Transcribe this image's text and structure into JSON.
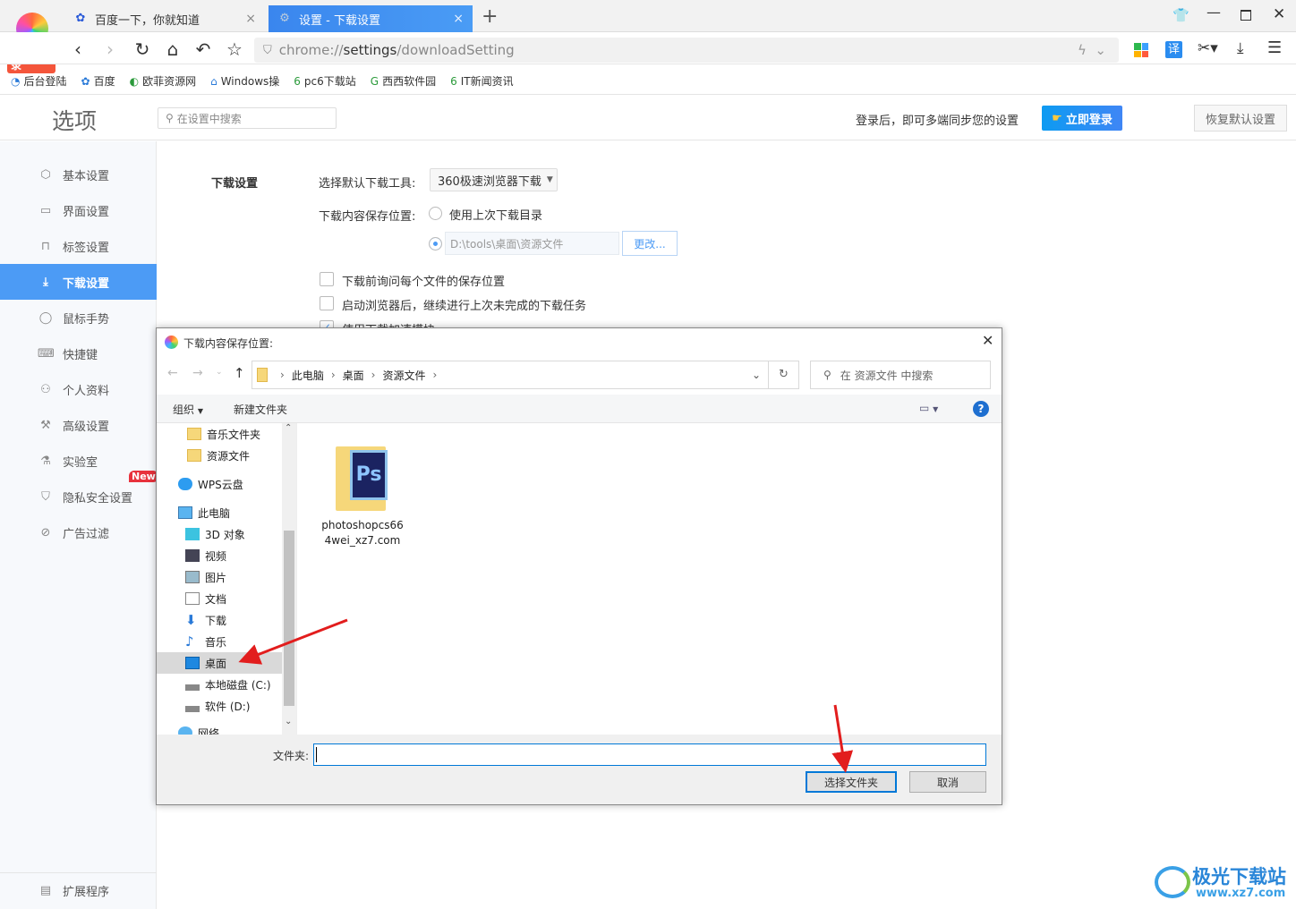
{
  "browser": {
    "login_badge": "立即登录",
    "tabs": [
      {
        "label": "百度一下，你就知道",
        "icon": "baidu-paw-icon"
      },
      {
        "label": "设置 - 下载设置",
        "icon": "gear-icon",
        "active": true
      }
    ],
    "url_scheme": "chrome://",
    "url_host": "settings",
    "url_path": "/downloadSetting",
    "bookmarks": [
      "后台登陆",
      "百度",
      "欧菲资源网",
      "Windows操",
      "pc6下载站",
      "西西软件园",
      "IT新闻资讯"
    ],
    "translate_label": "译"
  },
  "header": {
    "title": "选项",
    "search_placeholder": "在设置中搜索",
    "sync_text": "登录后，即可多端同步您的设置",
    "login_button": "立即登录",
    "restore_button": "恢复默认设置"
  },
  "sidebar": {
    "items": [
      {
        "label": "基本设置",
        "icon": "gear-icon"
      },
      {
        "label": "界面设置",
        "icon": "window-icon"
      },
      {
        "label": "标签设置",
        "icon": "tab-icon"
      },
      {
        "label": "下载设置",
        "icon": "download-icon",
        "active": true
      },
      {
        "label": "鼠标手势",
        "icon": "mouse-icon"
      },
      {
        "label": "快捷键",
        "icon": "keyboard-icon"
      },
      {
        "label": "个人资料",
        "icon": "user-icon"
      },
      {
        "label": "高级设置",
        "icon": "wrench-icon"
      },
      {
        "label": "实验室",
        "icon": "flask-icon"
      },
      {
        "label": "隐私安全设置",
        "icon": "shield-icon"
      },
      {
        "label": "广告过滤",
        "icon": "block-icon"
      }
    ],
    "new_badge": "New",
    "extensions": "扩展程序"
  },
  "download": {
    "section_title": "下载设置",
    "tool_label": "选择默认下载工具:",
    "tool_value": "360极速浏览器下载",
    "location_label": "下载内容保存位置:",
    "option_last": "使用上次下载目录",
    "path_value": "D:\\tools\\桌面\\资源文件",
    "change_button": "更改...",
    "ask_each": "下载前询问每个文件的保存位置",
    "resume": "启动浏览器后，继续进行上次未完成的下载任务",
    "accelerate": "使用下载加速模块"
  },
  "dialog": {
    "title": "下载内容保存位置:",
    "breadcrumb": [
      "此电脑",
      "桌面",
      "资源文件"
    ],
    "search_placeholder": "在 资源文件 中搜索",
    "organize": "组织",
    "new_folder": "新建文件夹",
    "nav": [
      {
        "label": "音乐文件夹",
        "icon": "folder-icon"
      },
      {
        "label": "资源文件",
        "icon": "folder-icon"
      },
      {
        "label": "WPS云盘",
        "icon": "cloud-icon"
      },
      {
        "label": "此电脑",
        "icon": "computer-icon"
      },
      {
        "label": "3D 对象",
        "icon": "cube-icon"
      },
      {
        "label": "视频",
        "icon": "video-icon"
      },
      {
        "label": "图片",
        "icon": "picture-icon"
      },
      {
        "label": "文档",
        "icon": "document-icon"
      },
      {
        "label": "下载",
        "icon": "download-arrow-icon"
      },
      {
        "label": "音乐",
        "icon": "music-icon"
      },
      {
        "label": "桌面",
        "icon": "desktop-icon",
        "selected": true
      },
      {
        "label": "本地磁盘 (C:)",
        "icon": "drive-icon"
      },
      {
        "label": "软件 (D:)",
        "icon": "drive-icon"
      },
      {
        "label": "网络",
        "icon": "network-icon"
      }
    ],
    "file": {
      "name_line1": "photoshopcs66",
      "name_line2": "4wei_xz7.com",
      "icon": "photoshop-folder-icon"
    },
    "folder_label": "文件夹:",
    "folder_value": "",
    "select_button": "选择文件夹",
    "cancel_button": "取消"
  },
  "watermark": {
    "text": "极光下载站",
    "url": "www.xz7.com"
  },
  "colors": {
    "accent": "#4c9bf5",
    "tab_active": "#3d8ef0",
    "new_badge": "#e8323c",
    "arrow": "#e21d1d"
  }
}
